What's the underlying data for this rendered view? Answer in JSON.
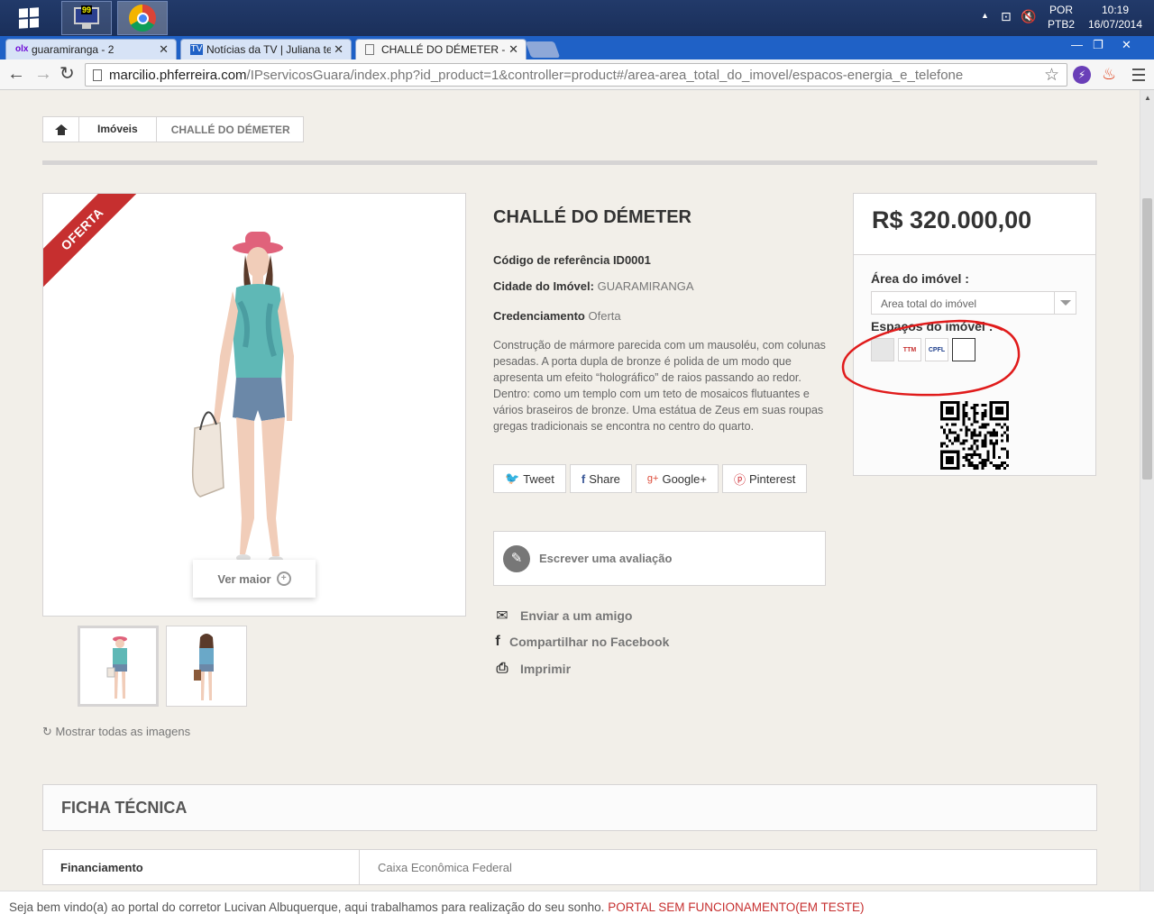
{
  "taskbar": {
    "lang_top": "POR",
    "lang_bottom": "PTB2",
    "time": "10:19",
    "date": "16/07/2014",
    "monitor_badge": "99"
  },
  "browser": {
    "tabs": [
      {
        "title": "guaramiranga - 2",
        "favicon": "olx-icon"
      },
      {
        "title": "Notícias da TV | Juliana tem",
        "favicon": "tv-icon"
      },
      {
        "title": "CHALLÉ DO DÉMETER - IP",
        "favicon": "page-icon"
      }
    ],
    "url_host": "marcilio.phferreira.com",
    "url_path": "/IPservicosGuara/index.php?id_product=1&controller=product#/area-area_total_do_imovel/espacos-energia_e_telefone"
  },
  "breadcrumb": {
    "item": "Imóveis",
    "current": "CHALLÉ DO DÉMETER"
  },
  "product": {
    "ribbon": "OFERTA",
    "zoom_label": "Ver maior",
    "show_all": "Mostrar todas as imagens",
    "title": "CHALLÉ DO DÉMETER",
    "ref_label": "Código de referência",
    "ref_value": "ID0001",
    "city_label": "Cidade do Imóvel:",
    "city_value": "GUARAMIRANGA",
    "cred_label": "Credenciamento",
    "cred_value": "Oferta",
    "description": "Construção de mármore parecida com um mausoléu, com colunas pesadas. A porta dupla de bronze é polida de um modo que apresenta um efeito “holográfico” de raios passando ao redor. Dentro: como um templo com um teto de mosaicos flutuantes e vários braseiros de bronze. Uma estátua de Zeus em suas roupas gregas tradicionais se encontra no centro do quarto.",
    "share": {
      "tweet": "Tweet",
      "share": "Share",
      "google": "Google+",
      "pinterest": "Pinterest"
    },
    "review": "Escrever uma avaliação",
    "actions": {
      "send": "Enviar a um amigo",
      "facebook": "Compartilhar no Facebook",
      "print": "Imprimir"
    }
  },
  "buybox": {
    "price": "R$ 320.000,00",
    "area_label": "Área do imóvel :",
    "area_selected": "Area total do imóvel",
    "spaces_label": "Espaços do imóvel :",
    "swatches": [
      "",
      "TTM",
      "CPFL",
      ""
    ]
  },
  "ficha": {
    "title": "FICHA TÉCNICA",
    "rows": [
      {
        "label": "Financiamento",
        "value": "Caixa Econômica Federal"
      }
    ]
  },
  "footer": {
    "text": "Seja bem vindo(a) ao portal do corretor Lucivan Albuquerque, aqui trabalhamos para realização do seu sonho.",
    "alert": "PORTAL SEM FUNCIONAMENTO(EM TESTE)"
  },
  "colors": {
    "accent_red": "#c62f2f",
    "page_bg": "#f2efe9",
    "taskbar": "#1a2f5a",
    "tabbar": "#1f61c6"
  }
}
